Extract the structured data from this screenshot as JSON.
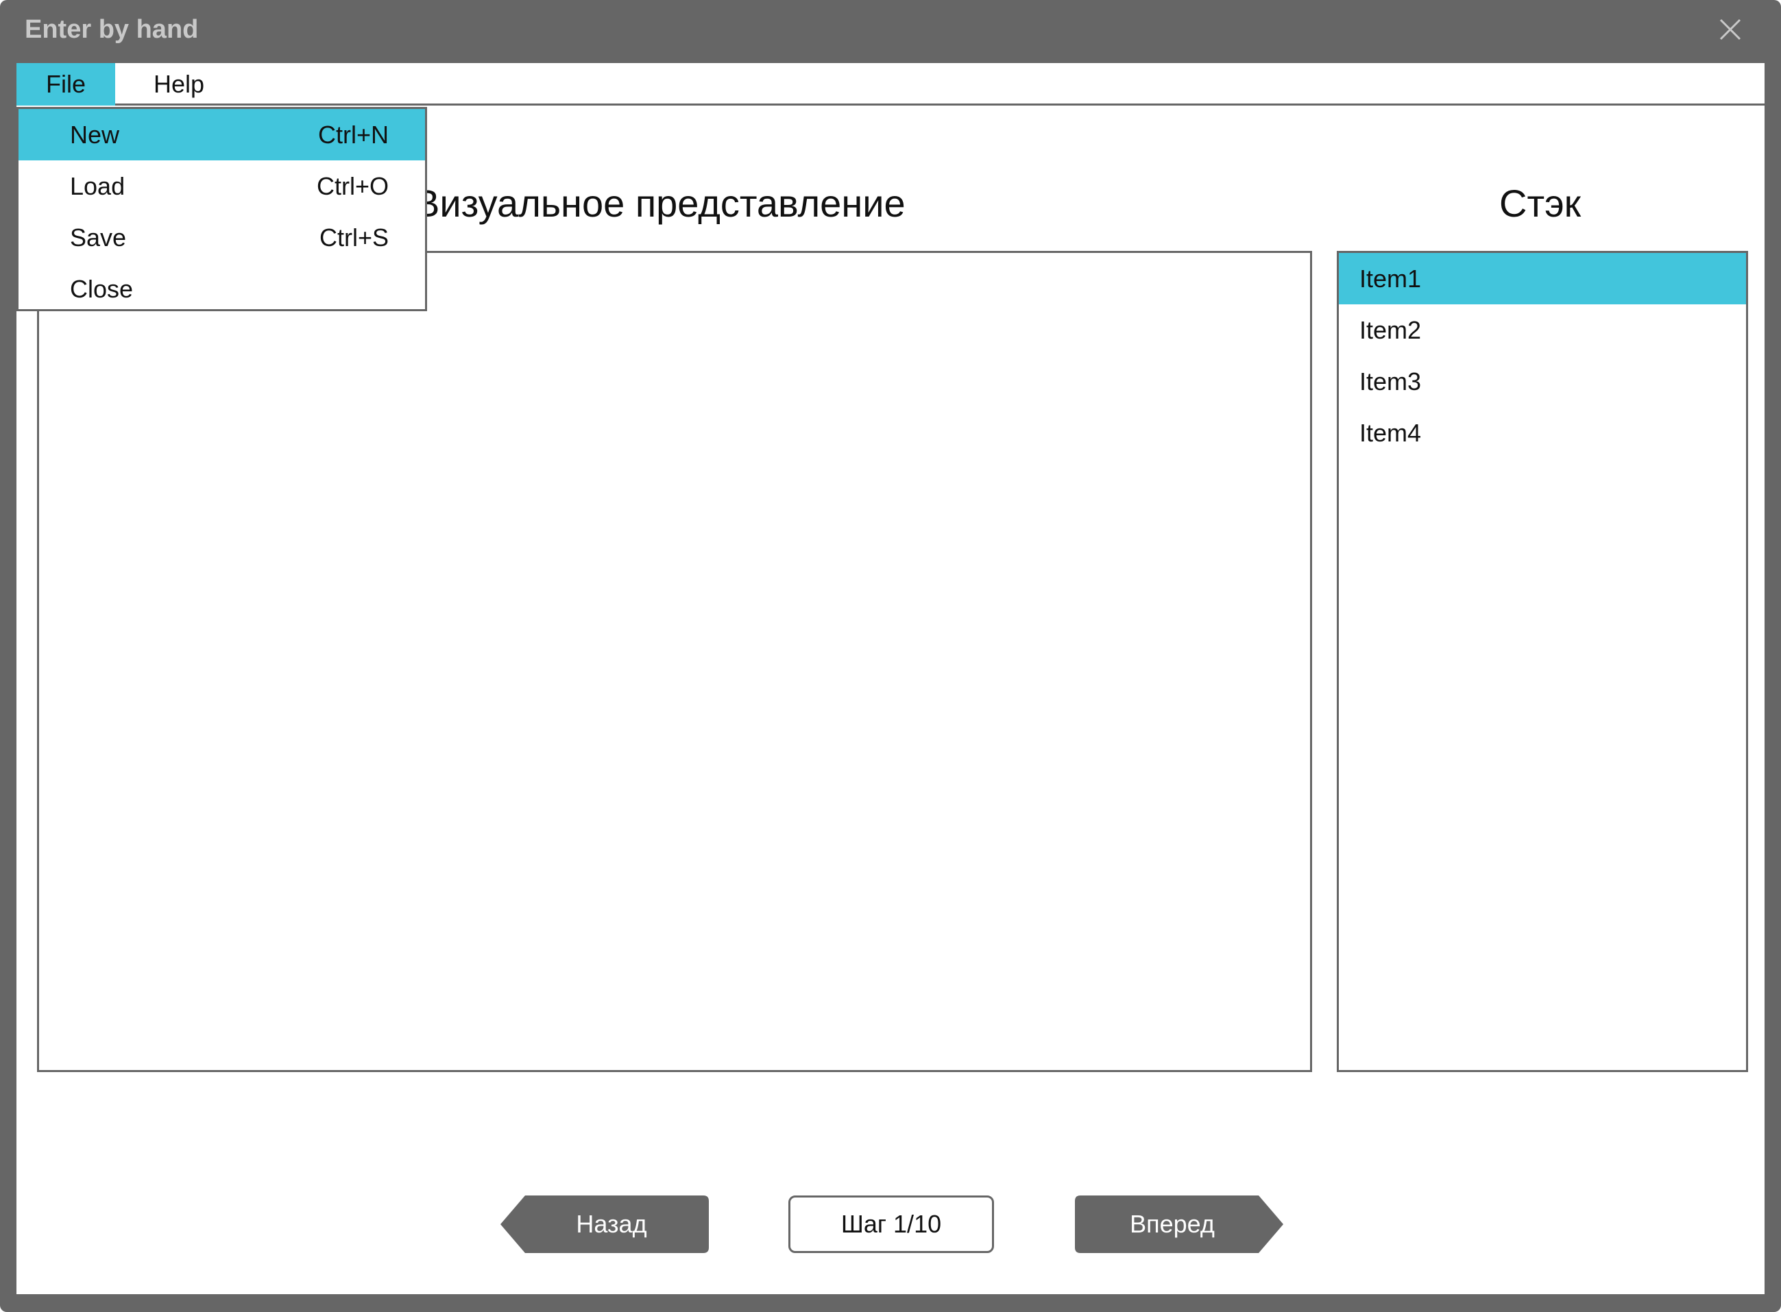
{
  "window": {
    "title": "Enter by hand"
  },
  "menubar": {
    "items": [
      {
        "label": "File"
      },
      {
        "label": "Help"
      }
    ]
  },
  "file_menu": {
    "items": [
      {
        "label": "New",
        "shortcut": "Ctrl+N"
      },
      {
        "label": "Load",
        "shortcut": "Ctrl+O"
      },
      {
        "label": "Save",
        "shortcut": "Ctrl+S"
      },
      {
        "label": "Close",
        "shortcut": ""
      }
    ]
  },
  "main": {
    "visual_heading": "Визуальное представление",
    "stack_heading": "Стэк",
    "stack_items": [
      {
        "label": "Item1"
      },
      {
        "label": "Item2"
      },
      {
        "label": "Item3"
      },
      {
        "label": "Item4"
      }
    ]
  },
  "navigation": {
    "back_label": "Назад",
    "step_label": "Шаг 1/10",
    "forward_label": "Вперед"
  },
  "colors": {
    "frame": "#666666",
    "accent": "#42c5dc",
    "title_text": "#c9c9c9",
    "background": "#ffffff"
  },
  "icons": {
    "close": "close-icon"
  }
}
